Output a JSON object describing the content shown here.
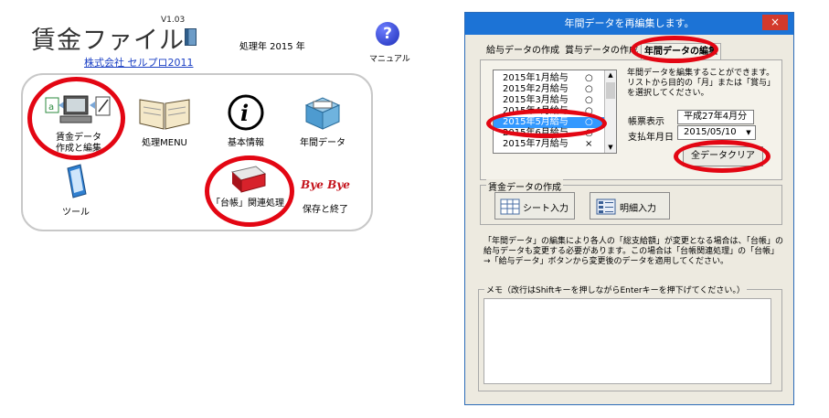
{
  "left": {
    "app_title": "賃金ファイル",
    "version": "V1.03",
    "processing_year": "処理年 2015 年",
    "company": "株式会社 セルプロ2011",
    "manual_label": "マニュアル",
    "menu": {
      "wage_data_line1": "賃金データ",
      "wage_data_line2": "作成と編集",
      "process_menu": "処理MENU",
      "basic_info": "基本情報",
      "annual_data": "年間データ",
      "tools": "ツール",
      "ledger_processing": "「台帳」関連処理",
      "bye_text": "Bye Bye",
      "save_exit": "保存と終了"
    }
  },
  "dialog": {
    "title": "年間データを再編集します。",
    "close_symbol": "×",
    "tabs": [
      "給与データの作成",
      "賞与データの作成",
      "年間データの編集"
    ],
    "months": [
      {
        "label": "2015年1月給与",
        "mark": "○"
      },
      {
        "label": "2015年2月給与",
        "mark": "○"
      },
      {
        "label": "2015年3月給与",
        "mark": "○"
      },
      {
        "label": "2015年4月給与",
        "mark": "○"
      },
      {
        "label": "2015年5月給与",
        "mark": "○"
      },
      {
        "label": "2015年6月給与",
        "mark": "○"
      },
      {
        "label": "2015年7月給与",
        "mark": "×"
      }
    ],
    "description": "年間データを編集することができます。リストから目的の「月」または「賞与」を選択してください。",
    "report_label": "帳票表示",
    "report_value": "平成27年4月分",
    "pay_month_label": "支払年月日",
    "pay_month_value": "2015/05/10",
    "clear_all_button": "全データクリア",
    "creation_group": "賃金データの作成",
    "sheet_input": "シート入力",
    "detail_input": "明細入力",
    "note": "「年間データ」の編集により各人の「総支給額」が変更となる場合は、「台帳」の給与データも変更する必要があります。この場合は「台帳関連処理」の「台帳」→「給与データ」ボタンから変更後のデータを適用してください。",
    "memo_label": "メモ（改行はShiftキーを押しながらEnterキーを押下げてください。）"
  },
  "colors": {
    "highlight_ring": "#e30613",
    "title_bar": "#1c73d6",
    "selection": "#3399ff"
  }
}
